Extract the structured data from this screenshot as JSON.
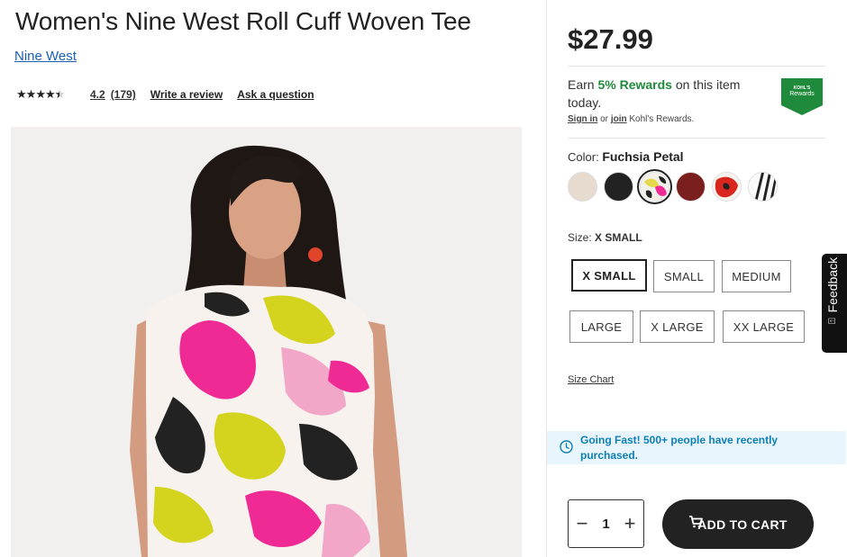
{
  "product": {
    "title": "Women's Nine West Roll Cuff Woven Tee",
    "brand": "Nine West",
    "rating_value": 4.2,
    "rating_text": "4.2",
    "review_count": "(179)",
    "write_review": "Write a review",
    "ask_question": "Ask a question"
  },
  "pricing": {
    "price": "$27.99"
  },
  "rewards": {
    "earn_prefix": "Earn",
    "earn_highlight": "5% Rewards",
    "earn_suffix": "on this item today.",
    "sign_in": "Sign in",
    "or_text": "or",
    "join": "join",
    "program": "Kohl's Rewards.",
    "badge_top": "KOHL'S",
    "badge_bottom": "Rewards",
    "badge_color": "#1f8a3b"
  },
  "color": {
    "label": "Color:",
    "selected": "Fuchsia Petal",
    "swatches": [
      {
        "name": "beige",
        "color": "#e7dace"
      },
      {
        "name": "black",
        "color": "#222222"
      },
      {
        "name": "fuchsia-petal",
        "color": "#e6d84a",
        "selected": true
      },
      {
        "name": "burgundy",
        "color": "#7a1e1e"
      },
      {
        "name": "red-print",
        "color": "#d8261f"
      },
      {
        "name": "black-white-stripe",
        "color": "#f4f4f4"
      }
    ]
  },
  "size": {
    "label": "Size:",
    "selected": "X SMALL",
    "options": [
      "X SMALL",
      "SMALL",
      "MEDIUM",
      "LARGE",
      "X LARGE",
      "XX LARGE"
    ],
    "size_chart": "Size Chart"
  },
  "urgency": {
    "text": "Going Fast! 500+ people have recently purchased.",
    "color": "#0d7fb5"
  },
  "cart": {
    "quantity": "1",
    "minus": "−",
    "plus": "+",
    "add_to_cart": "ADD TO CART"
  },
  "feedback": {
    "label": "Feedback"
  }
}
